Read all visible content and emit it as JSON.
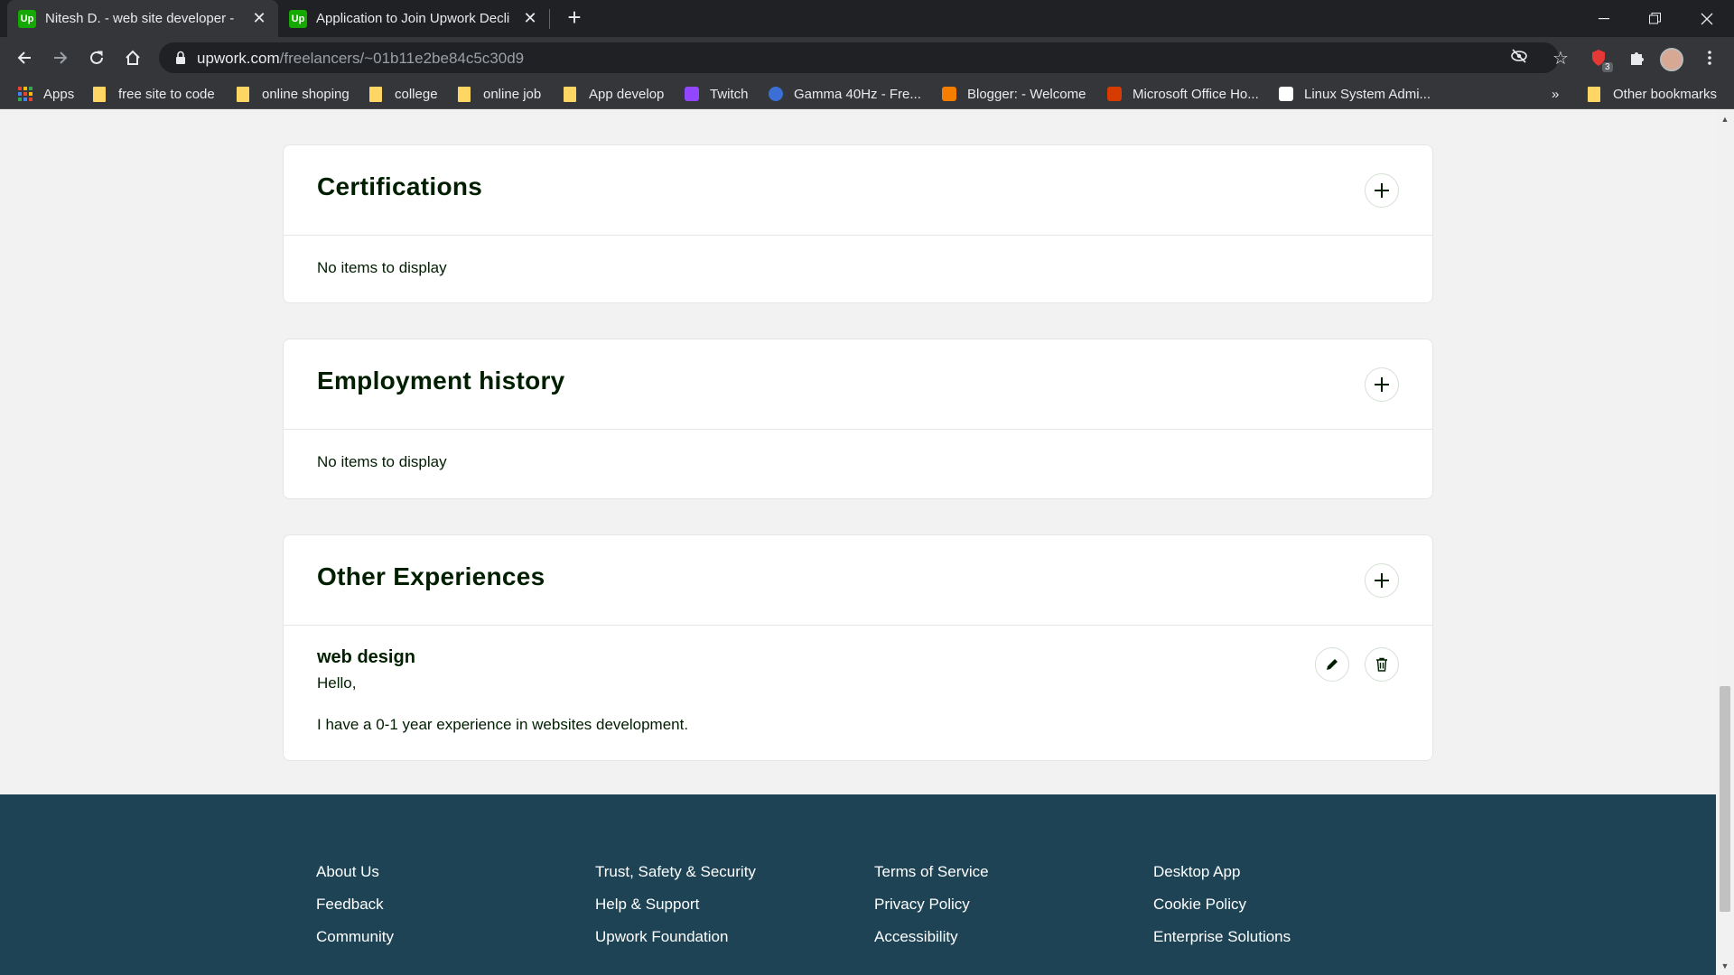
{
  "browser": {
    "tabs": [
      {
        "title": "Nitesh D. - web site developer - Upwork",
        "favicon": "Up",
        "active": true
      },
      {
        "title": "Application to Join Upwork Declined",
        "favicon": "Up",
        "active": false
      }
    ],
    "address": {
      "host": "upwork.com",
      "path": "/freelancers/~01b11e2be84c5c30d9"
    },
    "extension_badge": "3",
    "bookmarks": [
      {
        "label": "Apps",
        "icon": "apps-grid-icon"
      },
      {
        "label": "free site to code",
        "icon": "folder-icon"
      },
      {
        "label": "online shoping",
        "icon": "folder-icon"
      },
      {
        "label": "college",
        "icon": "folder-icon"
      },
      {
        "label": "online job",
        "icon": "folder-icon"
      },
      {
        "label": "App develop",
        "icon": "folder-icon"
      },
      {
        "label": "Twitch",
        "icon": "twitch-icon"
      },
      {
        "label": "Gamma 40Hz - Fre...",
        "icon": "gamma-icon"
      },
      {
        "label": "Blogger: - Welcome",
        "icon": "blogger-icon"
      },
      {
        "label": "Microsoft Office Ho...",
        "icon": "office-icon"
      },
      {
        "label": "Linux System Admi...",
        "icon": "linux-icon"
      }
    ],
    "bookmarks_overflow": "»",
    "other_bookmarks": "Other bookmarks"
  },
  "sections": {
    "certifications": {
      "title": "Certifications",
      "empty_text": "No items to display"
    },
    "employment": {
      "title": "Employment history",
      "empty_text": "No items to display"
    },
    "other": {
      "title": "Other Experiences",
      "item": {
        "title": "web design",
        "greeting": "Hello,",
        "description": "I have a 0-1 year experience in websites development."
      }
    }
  },
  "footer": {
    "col1": [
      "About Us",
      "Feedback",
      "Community"
    ],
    "col2": [
      "Trust, Safety & Security",
      "Help & Support",
      "Upwork Foundation"
    ],
    "col3": [
      "Terms of Service",
      "Privacy Policy",
      "Accessibility"
    ],
    "col4": [
      "Desktop App",
      "Cookie Policy",
      "Enterprise Solutions"
    ]
  },
  "colors": {
    "upwork_green": "#14a800",
    "footer_bg": "#1d4354",
    "page_bg": "#f2f2f2",
    "chrome_dark": "#202124",
    "chrome_toolbar": "#35363a"
  }
}
